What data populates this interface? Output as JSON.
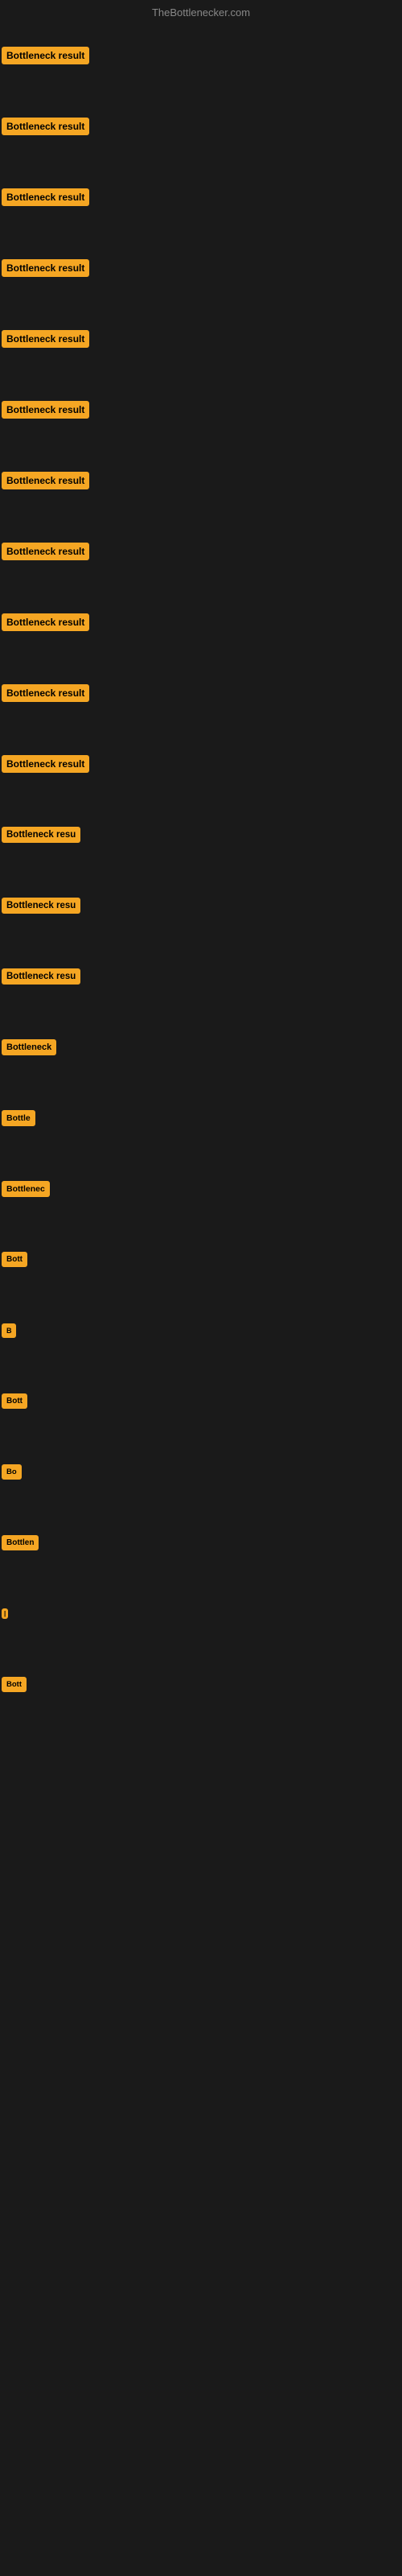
{
  "site": {
    "title": "TheBottlenecker.com"
  },
  "rows": [
    {
      "id": 1,
      "label": "Bottleneck result"
    },
    {
      "id": 2,
      "label": "Bottleneck result"
    },
    {
      "id": 3,
      "label": "Bottleneck result"
    },
    {
      "id": 4,
      "label": "Bottleneck result"
    },
    {
      "id": 5,
      "label": "Bottleneck result"
    },
    {
      "id": 6,
      "label": "Bottleneck result"
    },
    {
      "id": 7,
      "label": "Bottleneck result"
    },
    {
      "id": 8,
      "label": "Bottleneck result"
    },
    {
      "id": 9,
      "label": "Bottleneck result"
    },
    {
      "id": 10,
      "label": "Bottleneck result"
    },
    {
      "id": 11,
      "label": "Bottleneck result"
    },
    {
      "id": 12,
      "label": "Bottleneck resu"
    },
    {
      "id": 13,
      "label": "Bottleneck resu"
    },
    {
      "id": 14,
      "label": "Bottleneck resu"
    },
    {
      "id": 15,
      "label": "Bottleneck"
    },
    {
      "id": 16,
      "label": "Bottle"
    },
    {
      "id": 17,
      "label": "Bottlenec"
    },
    {
      "id": 18,
      "label": "Bott"
    },
    {
      "id": 19,
      "label": "B"
    },
    {
      "id": 20,
      "label": "Bott"
    },
    {
      "id": 21,
      "label": "Bo"
    },
    {
      "id": 22,
      "label": "Bottlen"
    },
    {
      "id": 23,
      "label": "|"
    },
    {
      "id": 24,
      "label": "Bott"
    }
  ]
}
